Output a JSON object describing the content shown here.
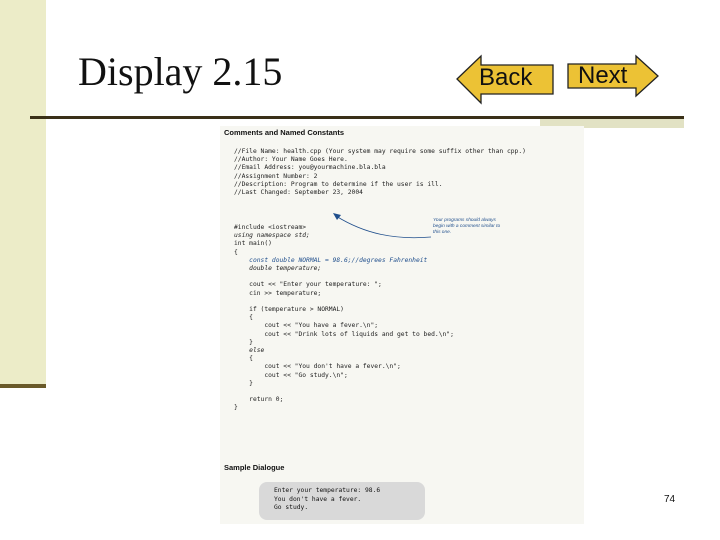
{
  "slide": {
    "title": "Display 2.15",
    "page_number": "74"
  },
  "nav": {
    "back_label": "Back",
    "next_label": "Next",
    "button_fill": "#ecc235",
    "button_border": "#222222"
  },
  "figure": {
    "heading": "Comments and Named Constants",
    "comments": [
      "//File Name: health.cpp (Your system may require some suffix other than cpp.)",
      "//Author: Your Name Goes Here.",
      "//Email Address: you@yourmachine.bla.bla",
      "//Assignment Number: 2",
      "//Description: Program to determine if the user is ill.",
      "//Last Changed: September 23, 2004"
    ],
    "annotation": "Your programs should always begin with a comment similar to this one.",
    "code_before": [
      "#include <iostream>",
      "using namespace std;",
      "int main()",
      "{"
    ],
    "const_line": "    const double NORMAL = 98.6;//degrees Fahrenheit",
    "code_after": [
      "    double temperature;",
      "",
      "    cout << \"Enter your temperature: \";",
      "    cin >> temperature;",
      "",
      "    if (temperature > NORMAL)",
      "    {",
      "        cout << \"You have a fever.\\n\";",
      "        cout << \"Drink lots of liquids and get to bed.\\n\";",
      "    }",
      "    else",
      "    {",
      "        cout << \"You don't have a fever.\\n\";",
      "        cout << \"Go study.\\n\";",
      "    }",
      "",
      "    return 0;",
      "}"
    ],
    "dialog_heading": "Sample Dialogue",
    "dialog_lines": [
      "Enter your temperature: 98.6",
      "You don't have a fever.",
      "Go study."
    ]
  }
}
